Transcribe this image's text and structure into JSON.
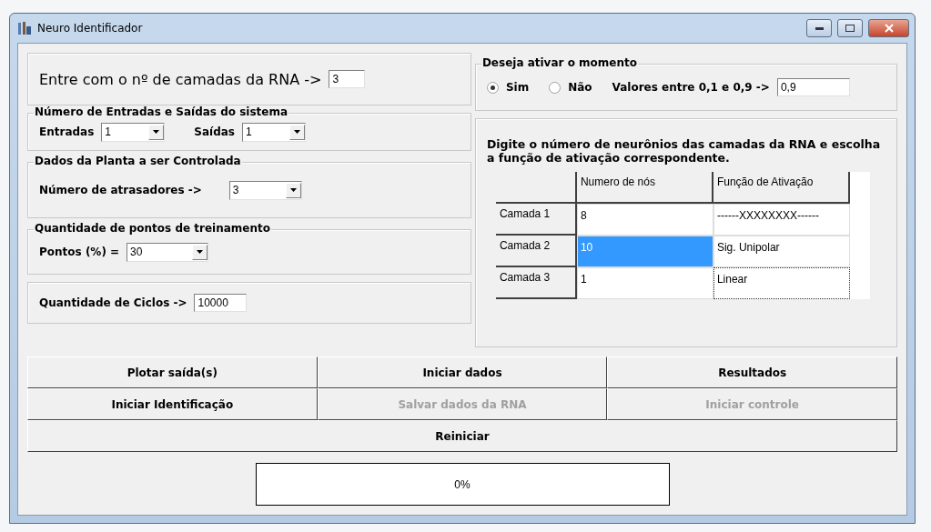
{
  "window": {
    "title": "Neuro Identificador"
  },
  "layers_box": {
    "label": "Entre com o nº de camadas da RNA ->",
    "value": "3"
  },
  "momentum": {
    "title": "Deseja ativar o momento",
    "options": [
      {
        "label": "Sim",
        "selected": true
      },
      {
        "label": "Não",
        "selected": false
      }
    ],
    "range_label": "Valores entre 0,1 e 0,9 ->",
    "value": "0,9"
  },
  "io_group": {
    "title": "Número de Entradas e Saídas do sistema",
    "fields": [
      {
        "label": "Entradas",
        "value": "1"
      },
      {
        "label": "Saídas",
        "value": "1"
      }
    ]
  },
  "plant_group": {
    "title": "Dados da Planta a ser Controlada",
    "label": "Número de atrasadores ->",
    "value": "3"
  },
  "training_group": {
    "title": "Quantidade de pontos de treinamento",
    "label": "Pontos (%) =",
    "value": "30"
  },
  "cycles_box": {
    "label": "Quantidade de Ciclos ->",
    "value": "10000"
  },
  "neurons_group": {
    "instructions": "Digite o número de neurônios das camadas da RNA e escolha a função de ativação correspondente.",
    "table": {
      "columns": [
        "Numero de nós",
        "Função de Ativação"
      ],
      "rows": [
        {
          "label": "Camada 1",
          "nodes": "8",
          "function": "------XXXXXXXX------",
          "selected": false,
          "focused": false
        },
        {
          "label": "Camada 2",
          "nodes": "10",
          "function": "Sig. Unipolar",
          "selected": true,
          "focused": false
        },
        {
          "label": "Camada 3",
          "nodes": "1",
          "function": "Linear",
          "selected": false,
          "focused": true
        }
      ]
    }
  },
  "buttons": [
    {
      "label": "Plotar saída(s)",
      "disabled": false
    },
    {
      "label": "Iniciar dados",
      "disabled": false
    },
    {
      "label": "Resultados",
      "disabled": false
    },
    {
      "label": "Iniciar Identificação",
      "disabled": false
    },
    {
      "label": "Salvar dados da RNA",
      "disabled": true
    },
    {
      "label": "Iniciar controle",
      "disabled": true
    },
    {
      "label": "Reiniciar",
      "disabled": false
    }
  ],
  "progress": {
    "text": "0%",
    "level": 0
  }
}
